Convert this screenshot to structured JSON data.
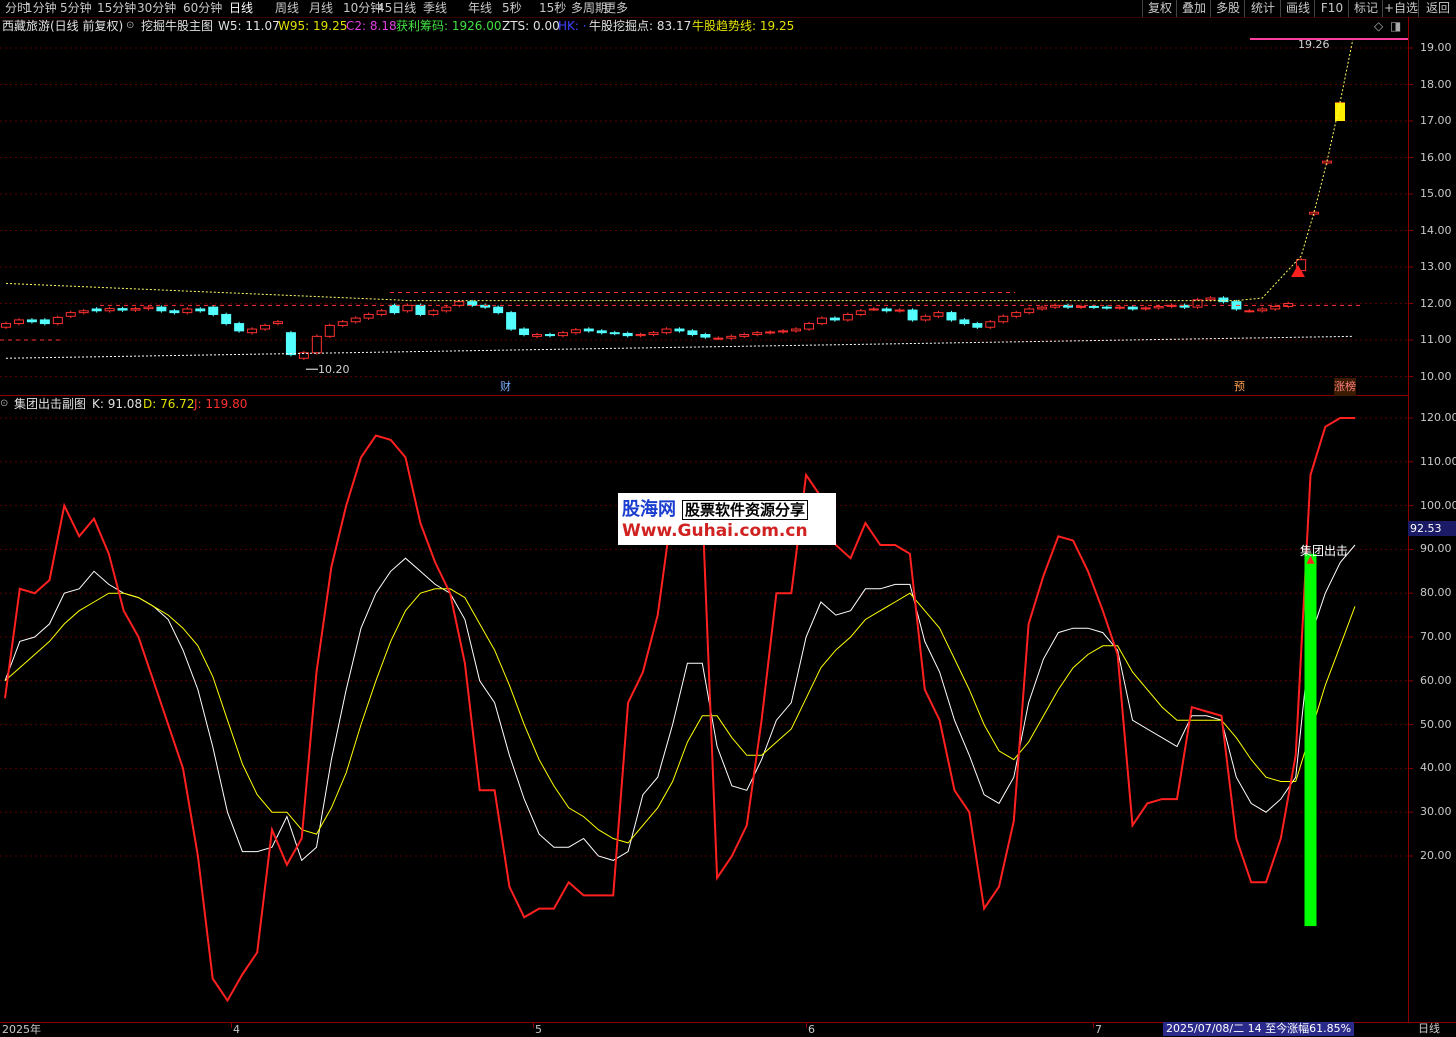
{
  "toolbar": {
    "periods": [
      "分时",
      "1分钟",
      "5分钟",
      "15分钟",
      "30分钟",
      "60分钟",
      "日线",
      "周线",
      "月线",
      "10分钟",
      "45日线",
      "季线",
      "年线",
      "5秒",
      "15秒",
      "多周期",
      "更多"
    ],
    "active_period": "日线",
    "right_buttons": [
      "复权",
      "叠加",
      "多股",
      "统计",
      "画线",
      "F10",
      "标记",
      "+自选",
      "返回"
    ]
  },
  "main_legend": {
    "stock": "西藏旅游(日线 前复权)",
    "indicator": "挖掘牛股主图",
    "items": [
      {
        "label": "W5: 11.07",
        "color": "#e0e0e0"
      },
      {
        "label": "W95: 19.25",
        "color": "#e0e000"
      },
      {
        "label": "C2: 8.18",
        "color": "#e040e0"
      },
      {
        "label": "获利筹码: 1926.00",
        "color": "#40e040"
      },
      {
        "label": "ZTS: 0.00",
        "color": "#e0e0e0"
      },
      {
        "label": "HK: ·",
        "color": "#4040ff"
      },
      {
        "label": "牛股挖掘点: 83.17",
        "color": "#e0e0e0"
      },
      {
        "label": "牛股趋势线: 19.25",
        "color": "#e0e000"
      }
    ]
  },
  "sub_legend": {
    "indicator": "集团出击副图",
    "k": "K: 91.08",
    "d": "D: 76.72",
    "j": "J: 119.80"
  },
  "price_axis": [
    "19.00",
    "18.00",
    "17.00",
    "16.00",
    "15.00",
    "14.00",
    "13.00",
    "12.00",
    "11.00",
    "10.00"
  ],
  "sub_axis": [
    "120.00",
    "110.00",
    "100.00",
    "90.00",
    "80.00",
    "70.00",
    "60.00",
    "50.00",
    "40.00",
    "30.00",
    "20.00"
  ],
  "current_value": "92.53",
  "annotations": {
    "high_label": "19.26",
    "low_label": "10.20",
    "marker_cai": "财",
    "marker_yu": "预",
    "marker_zhangting": "涨榜",
    "signal": "集团出击"
  },
  "watermark": {
    "line1": "股海网",
    "line1_sub": "股票软件资源分享",
    "line2": "Www.Guhai.com.cn"
  },
  "date_axis": [
    "2025年",
    "4",
    "5",
    "6",
    "7"
  ],
  "status": "2025/07/08/二 14 至今涨幅61.85%",
  "view_label": "日线",
  "colors": {
    "up": "#ff3030",
    "down": "#54ffff",
    "k_line": "#ffffff",
    "d_line": "#ffff00",
    "j_line": "#ff2020",
    "signal_bar": "#00ff00"
  },
  "chart_data": [
    {
      "type": "candlestick",
      "ylim": [
        9.7,
        19.5
      ],
      "close": [
        11.45,
        11.55,
        11.5,
        11.45,
        11.62,
        11.75,
        11.8,
        11.8,
        11.86,
        11.82,
        11.86,
        11.9,
        11.8,
        11.75,
        11.85,
        11.8,
        11.7,
        11.45,
        11.25,
        11.3,
        11.4,
        11.5,
        10.6,
        10.65,
        11.1,
        11.4,
        11.5,
        11.6,
        11.7,
        11.8,
        11.75,
        11.95,
        11.7,
        11.8,
        11.9,
        12.05,
        11.95,
        11.9,
        11.75,
        11.3,
        11.15,
        11.15,
        11.12,
        11.2,
        11.28,
        11.25,
        11.2,
        11.18,
        11.12,
        11.15,
        11.2,
        11.3,
        11.25,
        11.15,
        11.08,
        11.05,
        11.1,
        11.15,
        11.2,
        11.22,
        11.25,
        11.3,
        11.45,
        11.6,
        11.55,
        11.7,
        11.8,
        11.85,
        11.8,
        11.82,
        11.55,
        11.65,
        11.75,
        11.55,
        11.45,
        11.35,
        11.5,
        11.65,
        11.75,
        11.85,
        11.9,
        11.95,
        11.9,
        11.92,
        11.9,
        11.88,
        11.9,
        11.85,
        11.88,
        11.92,
        11.95,
        11.9,
        12.1,
        12.15,
        12.05,
        11.85,
        11.8,
        11.85,
        11.92,
        12.0,
        13.2,
        14.5,
        15.9,
        17.5
      ],
      "open": [
        11.35,
        11.45,
        11.55,
        11.55,
        11.45,
        11.65,
        11.75,
        11.85,
        11.8,
        11.86,
        11.82,
        11.86,
        11.9,
        11.8,
        11.75,
        11.85,
        11.9,
        11.7,
        11.45,
        11.2,
        11.3,
        11.45,
        11.2,
        10.5,
        10.65,
        11.1,
        11.4,
        11.5,
        11.6,
        11.7,
        11.95,
        11.8,
        11.95,
        11.7,
        11.8,
        11.95,
        12.05,
        11.95,
        11.9,
        11.75,
        11.3,
        11.1,
        11.15,
        11.12,
        11.2,
        11.3,
        11.25,
        11.2,
        11.18,
        11.12,
        11.15,
        11.2,
        11.3,
        11.25,
        11.15,
        11.05,
        11.05,
        11.1,
        11.15,
        11.2,
        11.22,
        11.25,
        11.3,
        11.45,
        11.6,
        11.55,
        11.7,
        11.85,
        11.85,
        11.8,
        11.82,
        11.55,
        11.65,
        11.75,
        11.55,
        11.45,
        11.35,
        11.5,
        11.65,
        11.75,
        11.85,
        11.9,
        11.95,
        11.9,
        11.92,
        11.9,
        11.88,
        11.9,
        11.85,
        11.88,
        11.92,
        11.95,
        11.9,
        12.1,
        12.15,
        12.05,
        11.8,
        11.8,
        11.85,
        11.92,
        12.9,
        14.45,
        15.85,
        17.2
      ],
      "dates_shown": [
        "2025年",
        "4",
        "5",
        "6",
        "7"
      ]
    },
    {
      "type": "line",
      "ylim": [
        0,
        125
      ],
      "series": [
        {
          "name": "K",
          "values": [
            60,
            69,
            70,
            73,
            80,
            81,
            85,
            82,
            80,
            79,
            77,
            74,
            67,
            58,
            45,
            30,
            21,
            21,
            22,
            29,
            19,
            22,
            42,
            58,
            72,
            80,
            85,
            88,
            85,
            82,
            80,
            74,
            60,
            55,
            43,
            33,
            25,
            22,
            22,
            24,
            20,
            19,
            21,
            34,
            38,
            50,
            64,
            64,
            45,
            36,
            35,
            42,
            51,
            55,
            70,
            78,
            75,
            76,
            81,
            81,
            82,
            82,
            69,
            62,
            51,
            43,
            34,
            32,
            38,
            55,
            65,
            71,
            72,
            72,
            71,
            67,
            51,
            49,
            47,
            45,
            52,
            52,
            51,
            38,
            32,
            30,
            33,
            38,
            70,
            80,
            87,
            91
          ]
        },
        {
          "name": "D",
          "values": [
            60,
            63,
            66,
            69,
            73,
            76,
            78,
            80,
            80,
            79,
            77,
            75,
            72,
            68,
            61,
            51,
            41,
            34,
            30,
            30,
            26,
            25,
            31,
            39,
            50,
            60,
            69,
            76,
            80,
            81,
            81,
            79,
            73,
            67,
            59,
            50,
            42,
            36,
            31,
            29,
            26,
            24,
            23,
            27,
            31,
            37,
            46,
            52,
            52,
            47,
            43,
            43,
            46,
            49,
            56,
            63,
            67,
            70,
            74,
            76,
            78,
            80,
            76,
            72,
            65,
            58,
            50,
            44,
            42,
            46,
            52,
            58,
            63,
            66,
            68,
            68,
            62,
            58,
            54,
            51,
            51,
            51,
            51,
            47,
            42,
            38,
            37,
            37,
            48,
            59,
            68,
            77
          ]
        },
        {
          "name": "J",
          "values": [
            56,
            81,
            80,
            83,
            100,
            93,
            97,
            89,
            76,
            70,
            60,
            50,
            40,
            20,
            -8,
            -13,
            -7,
            -2,
            26,
            18,
            24,
            62,
            86,
            100,
            111,
            116,
            115,
            111,
            96,
            87,
            80,
            64,
            35,
            35,
            13,
            6,
            8,
            8,
            14,
            11,
            11,
            11,
            55,
            62,
            75,
            100,
            100,
            100,
            15,
            20,
            27,
            51,
            80,
            80,
            107,
            102,
            91,
            88,
            96,
            91,
            91,
            89,
            58,
            51,
            35,
            30,
            8,
            13,
            28,
            73,
            84,
            93,
            92,
            85,
            76,
            66,
            27,
            32,
            33,
            33,
            54,
            53,
            52,
            24,
            14,
            14,
            24,
            43,
            107,
            118,
            120,
            120
          ]
        }
      ],
      "signal_bar": {
        "x_index": 88,
        "from": 4,
        "to": 89
      }
    }
  ]
}
